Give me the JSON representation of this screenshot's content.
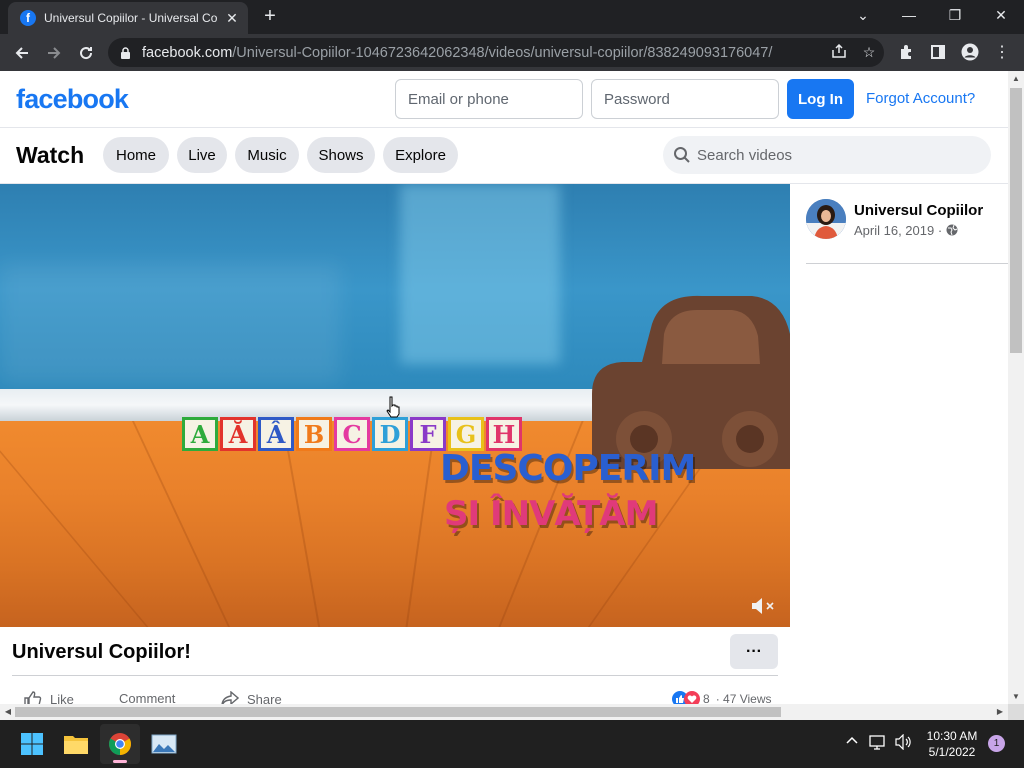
{
  "browser": {
    "tab_title": "Universul Copiilor - Universal Co",
    "tab_favicon": "f",
    "new_tab": "+",
    "url_host": "facebook.com",
    "url_path": "/Universul-Copiilor-1046723642062348/videos/universul-copiilor/838249093176047/",
    "controls": {
      "chevron": "⌄",
      "minimize": "—",
      "restore": "❐",
      "close": "✕"
    }
  },
  "header": {
    "logo": "facebook",
    "email_placeholder": "Email or phone",
    "password_placeholder": "Password",
    "login_label": "Log In",
    "forgot_label": "Forgot Account?"
  },
  "watch": {
    "title": "Watch",
    "tabs": [
      "Home",
      "Live",
      "Music",
      "Shows",
      "Explore"
    ],
    "search_placeholder": "Search videos"
  },
  "video": {
    "blocks": [
      {
        "letter": "A",
        "color": "#2eab3c"
      },
      {
        "letter": "Ă",
        "color": "#e2332c"
      },
      {
        "letter": "Â",
        "color": "#2e59c6"
      },
      {
        "letter": "B",
        "color": "#f07a1a"
      },
      {
        "letter": "C",
        "color": "#e43aa0"
      },
      {
        "letter": "D",
        "color": "#2fa0d8"
      },
      {
        "letter": "F",
        "color": "#8a3ac8"
      },
      {
        "letter": "G",
        "color": "#e8c11a"
      },
      {
        "letter": "H",
        "color": "#e0356a"
      }
    ],
    "line1": "DESCOPERIM",
    "line2": "ȘI ÎNVĂȚĂM",
    "title": "Universul Copiilor!",
    "more_label": "···"
  },
  "page": {
    "name": "Universul Copiilor",
    "date": "April 16, 2019 ·"
  },
  "actions": {
    "like": "Like",
    "comment": "Comment",
    "share": "Share",
    "reactions": "8",
    "views": "· 47 Views"
  },
  "taskbar": {
    "time": "10:30 AM",
    "date": "5/1/2022",
    "notifications": "1"
  }
}
